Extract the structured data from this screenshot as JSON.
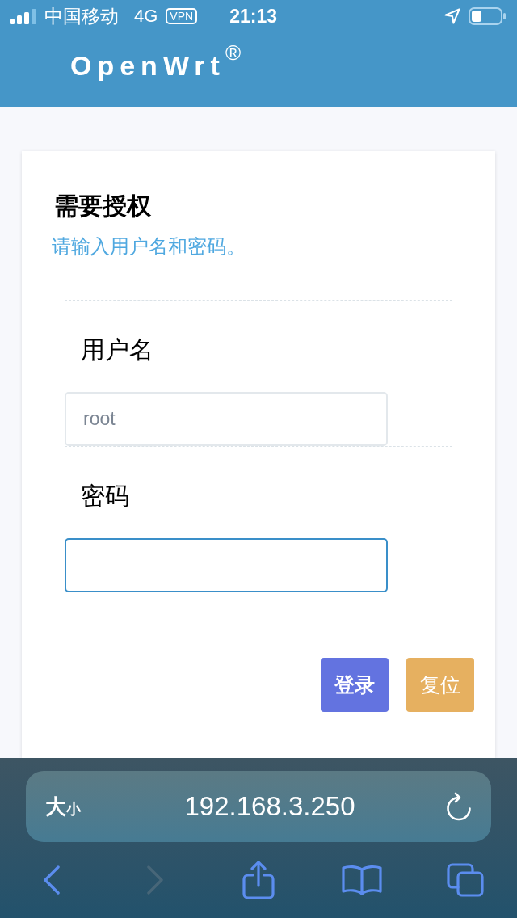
{
  "status_bar": {
    "carrier": "中国移动",
    "network": "4G",
    "vpn": "VPN",
    "time": "21:13"
  },
  "header": {
    "brand": "OpenWrt",
    "brand_mark": "®"
  },
  "login": {
    "title": "需要授权",
    "subtitle": "请输入用户名和密码。",
    "fields": [
      {
        "label": "用户名",
        "placeholder": "root",
        "focused": false
      },
      {
        "label": "密码",
        "focused": true
      }
    ],
    "buttons": [
      {
        "label": "登录",
        "kind": "primary"
      },
      {
        "label": "复位",
        "kind": "reset"
      }
    ]
  },
  "browser": {
    "text_size": {
      "large": "大",
      "small": "小"
    },
    "url": "192.168.3.250",
    "toolbar": [
      {
        "kind": "back",
        "disabled": false
      },
      {
        "kind": "forward",
        "disabled": true
      },
      {
        "kind": "share",
        "disabled": false
      },
      {
        "kind": "bookmarks",
        "disabled": false
      },
      {
        "kind": "tabs",
        "disabled": false
      }
    ]
  }
}
